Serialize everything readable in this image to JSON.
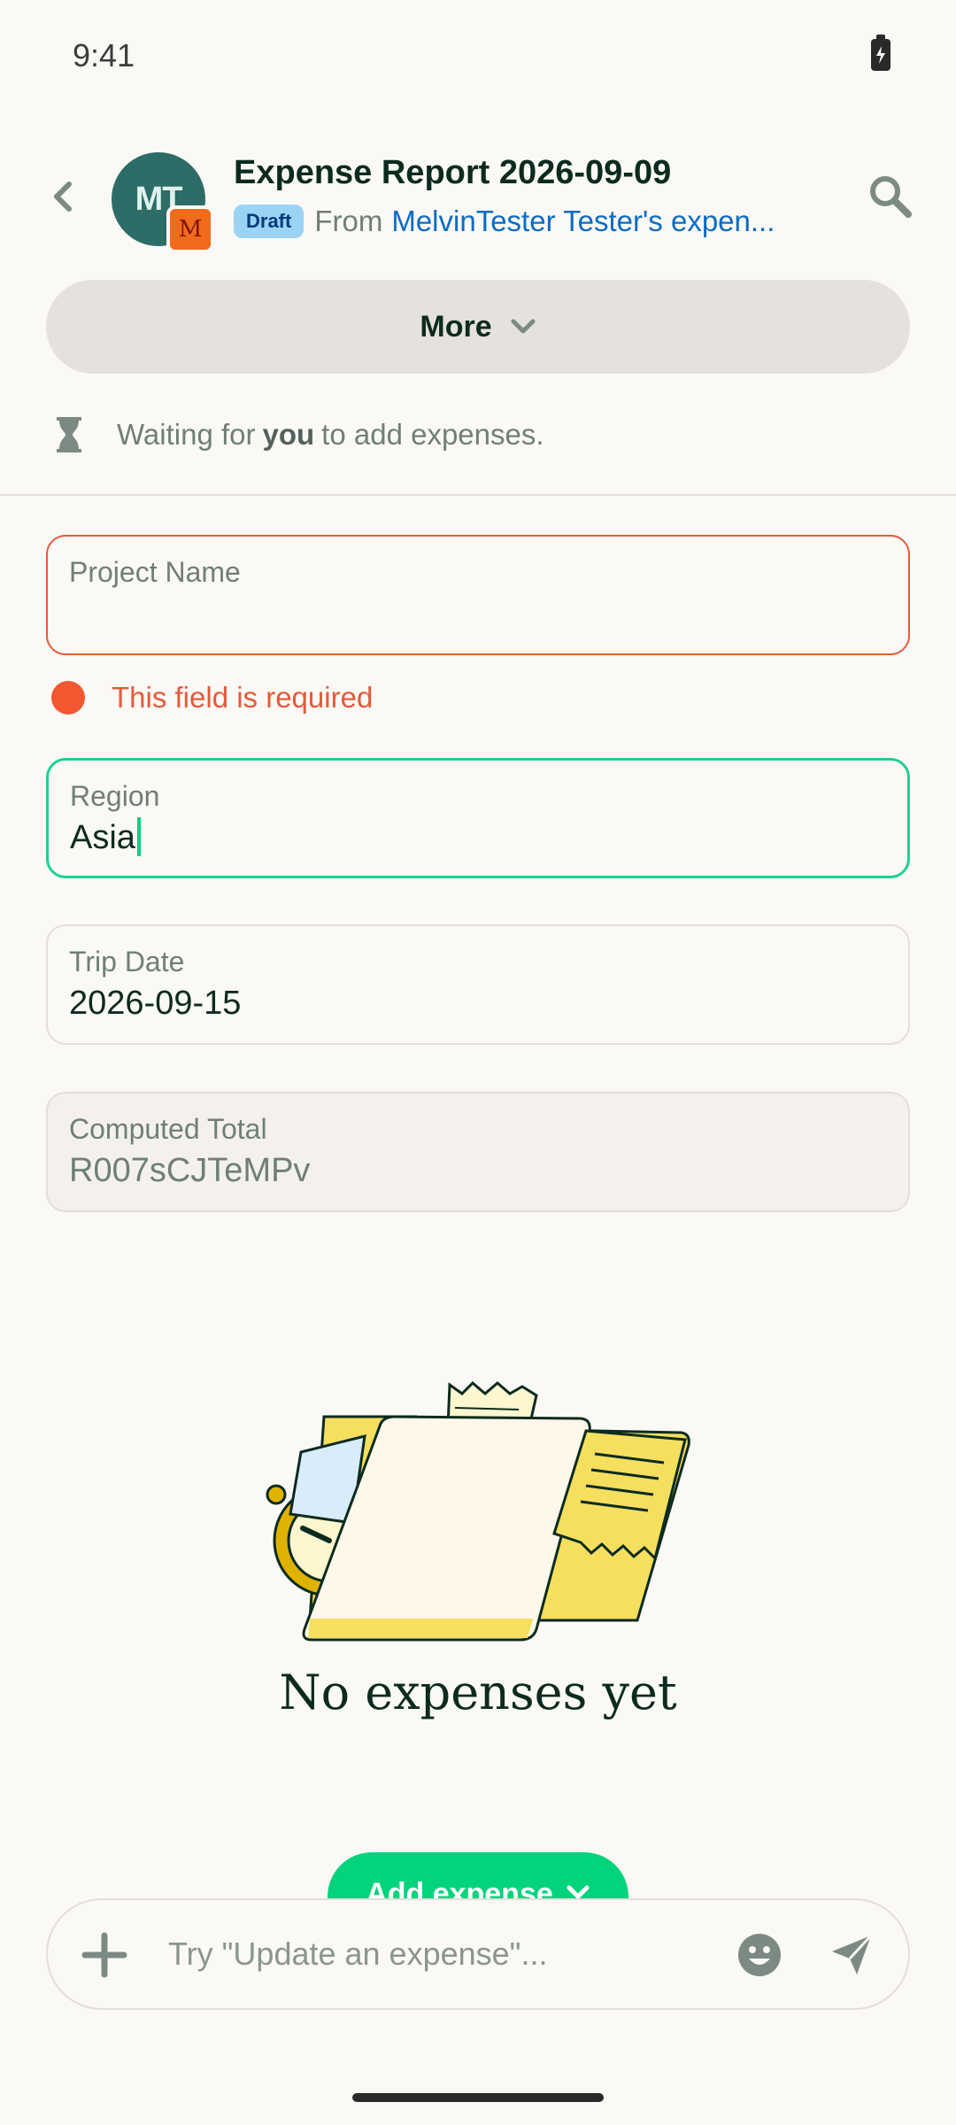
{
  "status_bar": {
    "time": "9:41"
  },
  "header": {
    "avatar_initials": "MT",
    "avatar_badge_letter": "M",
    "title": "Expense Report 2026-09-09",
    "status_pill": "Draft",
    "from_label": "From",
    "from_link": "MelvinTester Tester's expen..."
  },
  "more_button": {
    "label": "More"
  },
  "waiting": {
    "prefix": "Waiting for",
    "emphasis": "you",
    "suffix": "to add expenses."
  },
  "fields": {
    "project_name": {
      "label": "Project Name",
      "value": "",
      "error": "This field is required"
    },
    "region": {
      "label": "Region",
      "value": "Asia"
    },
    "trip_date": {
      "label": "Trip Date",
      "value": "2026-09-15"
    },
    "computed_total": {
      "label": "Computed Total",
      "value": "R007sCJTeMPv"
    }
  },
  "empty_state": {
    "title": "No expenses yet"
  },
  "add_expense": {
    "label": "Add expense"
  },
  "composer": {
    "placeholder": "Try \"Update an expense\"..."
  },
  "colors": {
    "accent_green": "#03d47c",
    "error_red": "#e45a3a",
    "link_blue": "#0a6bc4",
    "avatar_teal": "#2d6c67"
  }
}
